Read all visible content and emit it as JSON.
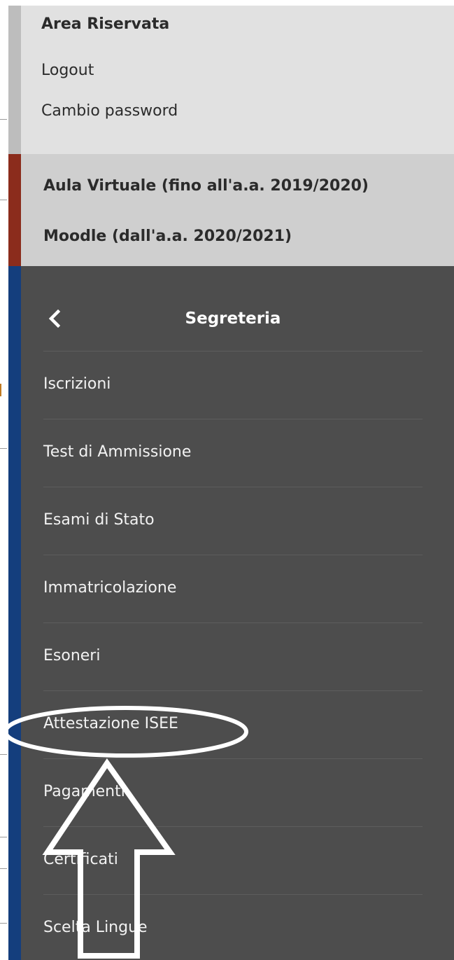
{
  "reserved_area": {
    "title": "Area Riservata",
    "links": [
      "Logout",
      "Cambio password"
    ]
  },
  "learning": {
    "aula_virtuale": "Aula Virtuale (fino all'a.a. 2019/2020)",
    "moodle": "Moodle (dall'a.a. 2020/2021)"
  },
  "segreteria": {
    "back_icon": "chevron-left-icon",
    "title": "Segreteria",
    "items": [
      "Iscrizioni",
      "Test di Ammissione",
      "Esami di Stato",
      "Immatricolazione",
      "Esoneri",
      "Attestazione ISEE",
      "Pagamenti",
      "Certificati",
      "Scelta Lingue"
    ]
  },
  "annotation": {
    "highlighted_item": "Attestazione ISEE",
    "shapes": [
      "ellipse-highlight",
      "up-arrow"
    ]
  },
  "colors": {
    "reserved_bg": "#e1e1e1",
    "learning_accent": "#8b2c1c",
    "segreteria_bg": "#4d4d4d",
    "segreteria_accent": "#143e7d"
  }
}
